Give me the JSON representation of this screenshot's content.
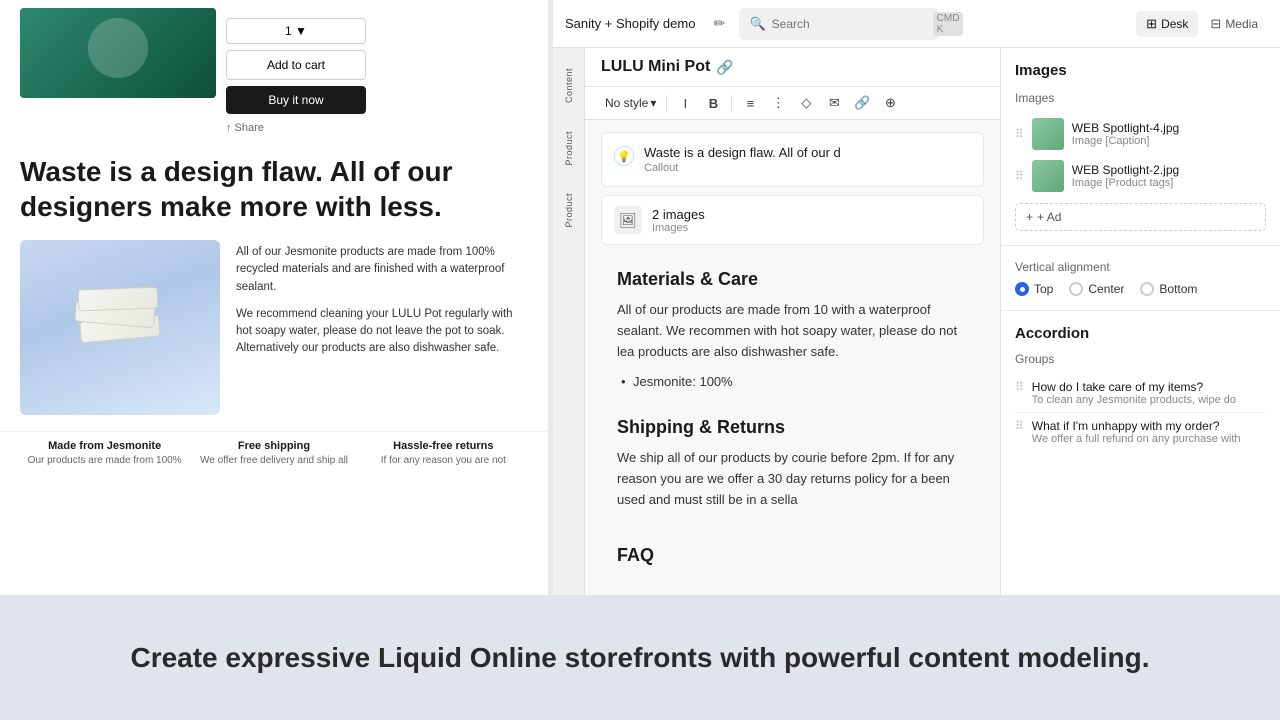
{
  "preview": {
    "tagline": "Waste is a design flaw. All of our designers make more with less.",
    "actions": {
      "add_to_cart": "Add to cart",
      "buy_now": "Buy it now",
      "share": "Share"
    },
    "feature_text_1": "All of our Jesmonite products are made from 100% recycled materials and are finished with a waterproof sealant.",
    "feature_text_2": "We recommend cleaning your LULU Pot regularly with hot soapy water, please do not leave the pot to soak. Alternatively our products are also dishwasher safe.",
    "badges": [
      {
        "title": "Made from Jesmonite",
        "desc": "Our products are made from 100%"
      },
      {
        "title": "Free shipping",
        "desc": "We offer free delivery and ship all"
      },
      {
        "title": "Hassle-free returns",
        "desc": "If for any reason you are not"
      }
    ]
  },
  "editor": {
    "app_title": "Sanity + Shopify demo",
    "search_placeholder": "Search",
    "search_shortcut": "CMD K",
    "view_tabs": [
      {
        "label": "Desk",
        "icon": "⊞",
        "active": true
      },
      {
        "label": "Media",
        "icon": "⊟",
        "active": false
      }
    ],
    "sidebar_items": [
      {
        "label": "Content"
      },
      {
        "label": "Product"
      },
      {
        "label": "Product"
      }
    ],
    "document": {
      "title": "LULU Mini Pot",
      "style_label": "No style",
      "format_buttons": [
        "I",
        "B",
        "≡",
        "⋮",
        "◇",
        "✉",
        "🔗",
        "⊕"
      ]
    },
    "callout_block": {
      "text": "Waste is a design flaw. All of our d",
      "label": "Callout"
    },
    "images_block": {
      "count": "2 images",
      "type": "Images"
    },
    "materials_section": {
      "heading": "Materials & Care",
      "text": "All of our products are made from 10 with a waterproof sealant. We recommen with hot soapy water, please do not lea products are also dishwasher safe.",
      "bullet": "Jesmonite: 100%"
    },
    "shipping_section": {
      "heading": "Shipping & Returns",
      "text": "We ship all of our products by courie before 2pm. If for any reason you are we offer a 30 day returns policy for a been used and must still be in a sella"
    },
    "faq_section": {
      "heading": "FAQ"
    }
  },
  "right_panel": {
    "images_section": {
      "title": "Images",
      "subsection": "Images",
      "items": [
        {
          "name": "WEB Spotlight-4.jpg",
          "meta": "Image [Caption]"
        },
        {
          "name": "WEB Spotlight-2.jpg",
          "meta": "Image [Product tags]"
        }
      ],
      "add_button": "+ Ad"
    },
    "vertical_alignment": {
      "title": "Vertical alignment",
      "options": [
        {
          "label": "Top",
          "selected": true
        },
        {
          "label": "Center",
          "selected": false
        },
        {
          "label": "Bottom",
          "selected": false
        }
      ]
    },
    "accordion": {
      "title": "Accordion",
      "groups_title": "Groups",
      "items": [
        {
          "title": "How do I take care of my items?",
          "preview": "To clean any Jesmonite products, wipe do"
        },
        {
          "title": "What if I'm unhappy with my order?",
          "preview": "We offer a full refund on any purchase with"
        }
      ]
    }
  },
  "bottom": {
    "tagline": "Create expressive Liquid Online storefronts with powerful content modeling."
  }
}
